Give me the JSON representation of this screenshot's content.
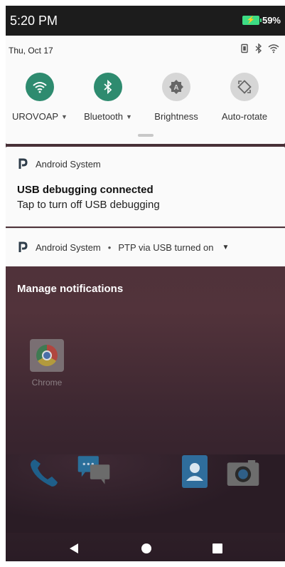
{
  "status_bar": {
    "time": "5:20 PM",
    "battery_percent": "59%",
    "battery_charging": true
  },
  "quick_settings": {
    "date": "Thu, Oct 17",
    "status_icons": [
      "vibrate-icon",
      "bluetooth-icon",
      "wifi-icon"
    ],
    "tiles": [
      {
        "label": "UROVOAP",
        "icon": "wifi-icon",
        "active": true,
        "has_dropdown": true
      },
      {
        "label": "Bluetooth",
        "icon": "bluetooth-icon",
        "active": true,
        "has_dropdown": true
      },
      {
        "label": "Brightness",
        "icon": "brightness-icon",
        "active": false,
        "has_dropdown": false
      },
      {
        "label": "Auto-rotate",
        "icon": "auto-rotate-icon",
        "active": false,
        "has_dropdown": false
      }
    ]
  },
  "notifications": [
    {
      "app": "Android System",
      "title": "USB debugging connected",
      "text": "Tap to turn off USB debugging"
    },
    {
      "app": "Android System",
      "separator": "•",
      "summary": "PTP via USB turned on"
    }
  ],
  "manage_notifications": "Manage notifications",
  "home_screen": {
    "apps": [
      {
        "label": "Chrome",
        "icon": "chrome-icon"
      }
    ],
    "dock": [
      "phone-icon",
      "messages-icon",
      "contacts-icon",
      "camera-icon"
    ]
  },
  "navigation": [
    "back-icon",
    "home-icon",
    "recents-icon"
  ],
  "colors": {
    "accent": "#2e8b6f",
    "battery": "#3ddc84",
    "panel": "#fafafa",
    "status_bar": "#1c1c1c"
  }
}
